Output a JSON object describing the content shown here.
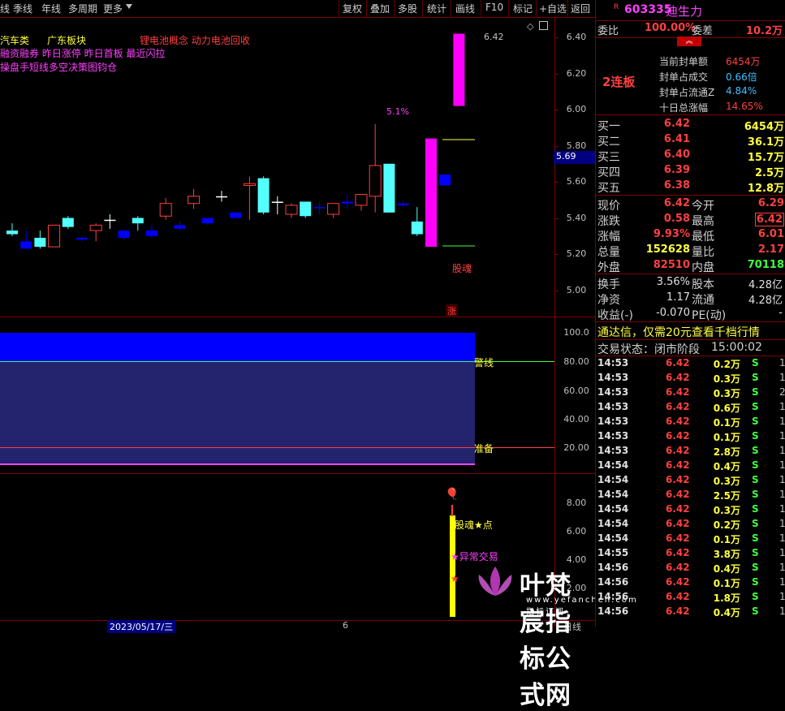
{
  "toolbar": {
    "left_items": [
      "线",
      "季线",
      "年线",
      "多周期",
      "更多"
    ],
    "right_items": [
      "复权",
      "叠加",
      "多股",
      "统计",
      "画线",
      "F10",
      "标记",
      "+自选",
      "返回"
    ]
  },
  "stock": {
    "code": "603335",
    "name": "迪生力",
    "r_badge": "R"
  },
  "tags": {
    "line1a": "汽车类",
    "line1b": "广东板块",
    "line1c": "锂电池概念 动力电池回收",
    "line2": "融资融券 昨日涨停 昨日首板 最近闪拉",
    "line3": "操盘手短线多空决策图钧仓"
  },
  "main_chart": {
    "y_ticks": [
      "6.40",
      "6.20",
      "6.00",
      "5.80",
      "5.60",
      "5.40",
      "5.20",
      "5.00"
    ],
    "current_price_tag": "5.69",
    "high_label": "6.42",
    "pct_label": "5.1%",
    "marker_label": "股魂",
    "zhang_label": "涨"
  },
  "chart_data": {
    "type": "candlestick",
    "y_range": [
      4.95,
      6.5
    ],
    "candles": [
      {
        "o": 5.33,
        "h": 5.37,
        "l": 5.3,
        "c": 5.31,
        "color": "cyan"
      },
      {
        "o": 5.27,
        "h": 5.33,
        "l": 5.23,
        "c": 5.23,
        "color": "blue"
      },
      {
        "o": 5.29,
        "h": 5.33,
        "l": 5.23,
        "c": 5.24,
        "color": "cyan"
      },
      {
        "o": 5.24,
        "h": 5.36,
        "l": 5.24,
        "c": 5.36,
        "color": "red"
      },
      {
        "o": 5.4,
        "h": 5.41,
        "l": 5.34,
        "c": 5.35,
        "color": "cyan"
      },
      {
        "o": 5.29,
        "h": 5.3,
        "l": 5.27,
        "c": 5.28,
        "color": "blue"
      },
      {
        "o": 5.33,
        "h": 5.37,
        "l": 5.27,
        "c": 5.36,
        "color": "red"
      },
      {
        "o": 5.39,
        "h": 5.42,
        "l": 5.34,
        "c": 5.39,
        "color": "white"
      },
      {
        "o": 5.33,
        "h": 5.33,
        "l": 5.28,
        "c": 5.29,
        "color": "blue"
      },
      {
        "o": 5.4,
        "h": 5.41,
        "l": 5.33,
        "c": 5.37,
        "color": "cyan"
      },
      {
        "o": 5.33,
        "h": 5.36,
        "l": 5.29,
        "c": 5.3,
        "color": "blue"
      },
      {
        "o": 5.41,
        "h": 5.51,
        "l": 5.39,
        "c": 5.48,
        "color": "red"
      },
      {
        "o": 5.36,
        "h": 5.38,
        "l": 5.33,
        "c": 5.34,
        "color": "blue"
      },
      {
        "o": 5.48,
        "h": 5.56,
        "l": 5.45,
        "c": 5.52,
        "color": "red"
      },
      {
        "o": 5.4,
        "h": 5.4,
        "l": 5.36,
        "c": 5.37,
        "color": "blue"
      },
      {
        "o": 5.52,
        "h": 5.55,
        "l": 5.49,
        "c": 5.52,
        "color": "white"
      },
      {
        "o": 5.43,
        "h": 5.43,
        "l": 5.4,
        "c": 5.4,
        "color": "blue"
      },
      {
        "o": 5.58,
        "h": 5.63,
        "l": 5.39,
        "c": 5.59,
        "color": "red"
      },
      {
        "o": 5.62,
        "h": 5.63,
        "l": 5.42,
        "c": 5.43,
        "color": "cyan"
      },
      {
        "o": 5.49,
        "h": 5.52,
        "l": 5.42,
        "c": 5.46,
        "color": "white"
      },
      {
        "o": 5.42,
        "h": 5.48,
        "l": 5.4,
        "c": 5.47,
        "color": "red"
      },
      {
        "o": 5.49,
        "h": 5.49,
        "l": 5.4,
        "c": 5.41,
        "color": "cyan"
      },
      {
        "o": 5.46,
        "h": 5.49,
        "l": 5.42,
        "c": 5.46,
        "color": "blue"
      },
      {
        "o": 5.42,
        "h": 5.48,
        "l": 5.4,
        "c": 5.48,
        "color": "red"
      },
      {
        "o": 5.49,
        "h": 5.53,
        "l": 5.45,
        "c": 5.48,
        "color": "blue"
      },
      {
        "o": 5.47,
        "h": 5.53,
        "l": 5.44,
        "c": 5.53,
        "color": "red"
      },
      {
        "o": 5.52,
        "h": 5.92,
        "l": 5.43,
        "c": 5.69,
        "color": "red"
      },
      {
        "o": 5.7,
        "h": 5.7,
        "l": 5.43,
        "c": 5.43,
        "color": "cyan"
      },
      {
        "o": 5.48,
        "h": 5.49,
        "l": 5.46,
        "c": 5.47,
        "color": "blue"
      },
      {
        "o": 5.38,
        "h": 5.46,
        "l": 5.3,
        "c": 5.31,
        "color": "cyan"
      },
      {
        "o": 5.24,
        "h": 5.84,
        "l": 5.24,
        "c": 5.84,
        "color": "magenta"
      },
      {
        "o": 5.64,
        "h": 5.64,
        "l": 5.58,
        "c": 5.58,
        "color": "blue"
      },
      {
        "o": 6.02,
        "h": 6.42,
        "l": 6.02,
        "c": 6.42,
        "color": "magenta"
      }
    ]
  },
  "mid_chart": {
    "y_ticks": [
      "100.0",
      "80.00",
      "60.00",
      "40.00",
      "20.00"
    ],
    "warn_label": "警线",
    "ready_label": "准备"
  },
  "low_chart": {
    "y_ticks": [
      "8.00",
      "6.00",
      "4.00",
      "2.00"
    ],
    "label_a": "股魂★点",
    "label_b": "★异常交易",
    "label_c": "★"
  },
  "bottom": {
    "date": "2023/05/17/三",
    "mark": "6",
    "axis_label": "日线"
  },
  "right": {
    "weibi_label": "委比",
    "weibi_value": "100.00%",
    "weicha_label": "委差",
    "weicha_value": "10.2万",
    "board_label": "2连板",
    "info": [
      {
        "label": "当前封单额",
        "value": "6454万"
      },
      {
        "label": "封单占成交",
        "value": "0.66倍"
      },
      {
        "label": "封单占流通Z",
        "value": "4.84%"
      },
      {
        "label": "十日总涨幅",
        "value": "14.65%"
      }
    ],
    "bids": [
      {
        "label": "买一",
        "price": "6.42",
        "vol": "6454万"
      },
      {
        "label": "买二",
        "price": "6.41",
        "vol": "36.1万"
      },
      {
        "label": "买三",
        "price": "6.40",
        "vol": "15.7万"
      },
      {
        "label": "买四",
        "price": "6.39",
        "vol": "2.5万"
      },
      {
        "label": "买五",
        "price": "6.38",
        "vol": "12.8万"
      }
    ],
    "quote": [
      {
        "l1": "现价",
        "v1": "6.42",
        "l2": "今开",
        "v2": "6.29"
      },
      {
        "l1": "涨跌",
        "v1": "0.58",
        "l2": "最高",
        "v2": "6.42"
      },
      {
        "l1": "涨幅",
        "v1": "9.93%",
        "l2": "最低",
        "v2": "6.01"
      },
      {
        "l1": "总量",
        "v1": "152628",
        "l2": "量比",
        "v2": "2.17"
      },
      {
        "l1": "外盘",
        "v1": "82510",
        "l2": "内盘",
        "v2": "70118"
      }
    ],
    "fund": [
      {
        "l1": "换手",
        "v1": "3.56%",
        "l2": "股本",
        "v2": "4.28亿"
      },
      {
        "l1": "净资",
        "v1": "1.17",
        "l2": "流通",
        "v2": "4.28亿"
      },
      {
        "l1": "收益(-)",
        "v1": "-0.070",
        "l2": "PE(动)",
        "v2": "-"
      }
    ],
    "promo": "通达信，仅需20元查看千档行情",
    "status_label": "交易状态：闭市阶段",
    "status_time": "15:00:02",
    "ticks": [
      {
        "t": "14:53",
        "p": "6.42",
        "v": "0.2万",
        "s": "S",
        "n": "1"
      },
      {
        "t": "14:53",
        "p": "6.42",
        "v": "0.3万",
        "s": "S",
        "n": "1"
      },
      {
        "t": "14:53",
        "p": "6.42",
        "v": "0.3万",
        "s": "S",
        "n": "2"
      },
      {
        "t": "14:53",
        "p": "6.42",
        "v": "0.6万",
        "s": "S",
        "n": "1"
      },
      {
        "t": "14:53",
        "p": "6.42",
        "v": "0.1万",
        "s": "S",
        "n": "1"
      },
      {
        "t": "14:53",
        "p": "6.42",
        "v": "0.1万",
        "s": "S",
        "n": "1"
      },
      {
        "t": "14:53",
        "p": "6.42",
        "v": "2.8万",
        "s": "S",
        "n": "1"
      },
      {
        "t": "14:54",
        "p": "6.42",
        "v": "0.4万",
        "s": "S",
        "n": "1"
      },
      {
        "t": "14:54",
        "p": "6.42",
        "v": "0.3万",
        "s": "S",
        "n": "1"
      },
      {
        "t": "14:54",
        "p": "6.42",
        "v": "2.5万",
        "s": "S",
        "n": "1"
      },
      {
        "t": "14:54",
        "p": "6.42",
        "v": "0.3万",
        "s": "S",
        "n": "1"
      },
      {
        "t": "14:54",
        "p": "6.42",
        "v": "0.2万",
        "s": "S",
        "n": "1"
      },
      {
        "t": "14:54",
        "p": "6.42",
        "v": "0.1万",
        "s": "S",
        "n": "1"
      },
      {
        "t": "14:55",
        "p": "6.42",
        "v": "3.8万",
        "s": "S",
        "n": "1"
      },
      {
        "t": "14:56",
        "p": "6.42",
        "v": "0.4万",
        "s": "S",
        "n": "1"
      },
      {
        "t": "14:56",
        "p": "6.42",
        "v": "0.1万",
        "s": "S",
        "n": "1"
      },
      {
        "t": "14:56",
        "p": "6.42",
        "v": "1.8万",
        "s": "S",
        "n": "1"
      },
      {
        "t": "14:56",
        "p": "6.42",
        "v": "0.4万",
        "s": "S",
        "n": "1"
      }
    ]
  },
  "watermark": {
    "text": "叶梵宸指标公式网",
    "sub": "www.yefanchen.com 指标订阅"
  },
  "colors": {
    "up": "#ff4040",
    "cyan": "#54ffff",
    "blue": "#0000ff",
    "magenta": "#ff00ff",
    "axis": "#800000"
  }
}
